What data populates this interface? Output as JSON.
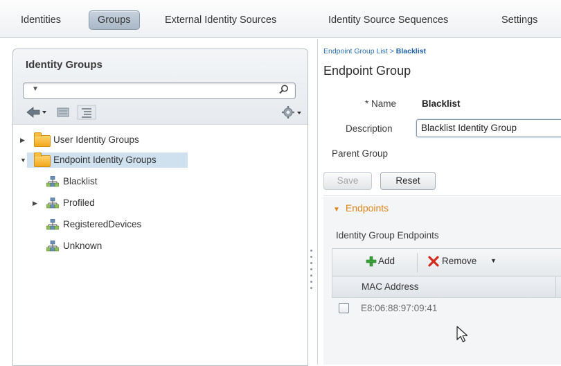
{
  "top_tabs": [
    {
      "label": "Identities",
      "active": false
    },
    {
      "label": "Groups",
      "active": true
    },
    {
      "label": "External Identity Sources",
      "active": false
    },
    {
      "label": "Identity Source Sequences",
      "active": false
    },
    {
      "label": "Settings",
      "active": false
    }
  ],
  "left_panel": {
    "title": "Identity Groups",
    "search": {
      "value": ""
    },
    "tree": [
      {
        "label": "User Identity Groups",
        "type": "folder",
        "expanded": false
      },
      {
        "label": "Endpoint Identity Groups",
        "type": "folder",
        "expanded": true,
        "selected": true
      },
      {
        "label": "Blacklist",
        "type": "group"
      },
      {
        "label": "Profiled",
        "type": "group",
        "expandable": true
      },
      {
        "label": "RegisteredDevices",
        "type": "group"
      },
      {
        "label": "Unknown",
        "type": "group"
      }
    ]
  },
  "right_panel": {
    "breadcrumb": {
      "parent": "Endpoint Group List",
      "separator": " > ",
      "current": "Blacklist"
    },
    "title": "Endpoint Group",
    "form": {
      "name_label": "* Name",
      "name_value": "Blacklist",
      "description_label": "Description",
      "description_value": "Blacklist Identity Group",
      "parent_group_label": "Parent Group"
    },
    "buttons": {
      "save": "Save",
      "reset": "Reset"
    },
    "endpoints": {
      "section_title": "Endpoints",
      "subtitle": "Identity Group Endpoints",
      "add_label": "Add",
      "remove_label": "Remove",
      "column_header": "MAC Address",
      "rows": [
        {
          "mac": "E8:06:88:97:09:41"
        }
      ]
    }
  },
  "colors": {
    "accent_orange": "#e0861a",
    "link_blue": "#2a6fb0",
    "selection_blue": "#cfe0ee",
    "add_green": "#3aa33a",
    "remove_red": "#d42a1e"
  }
}
